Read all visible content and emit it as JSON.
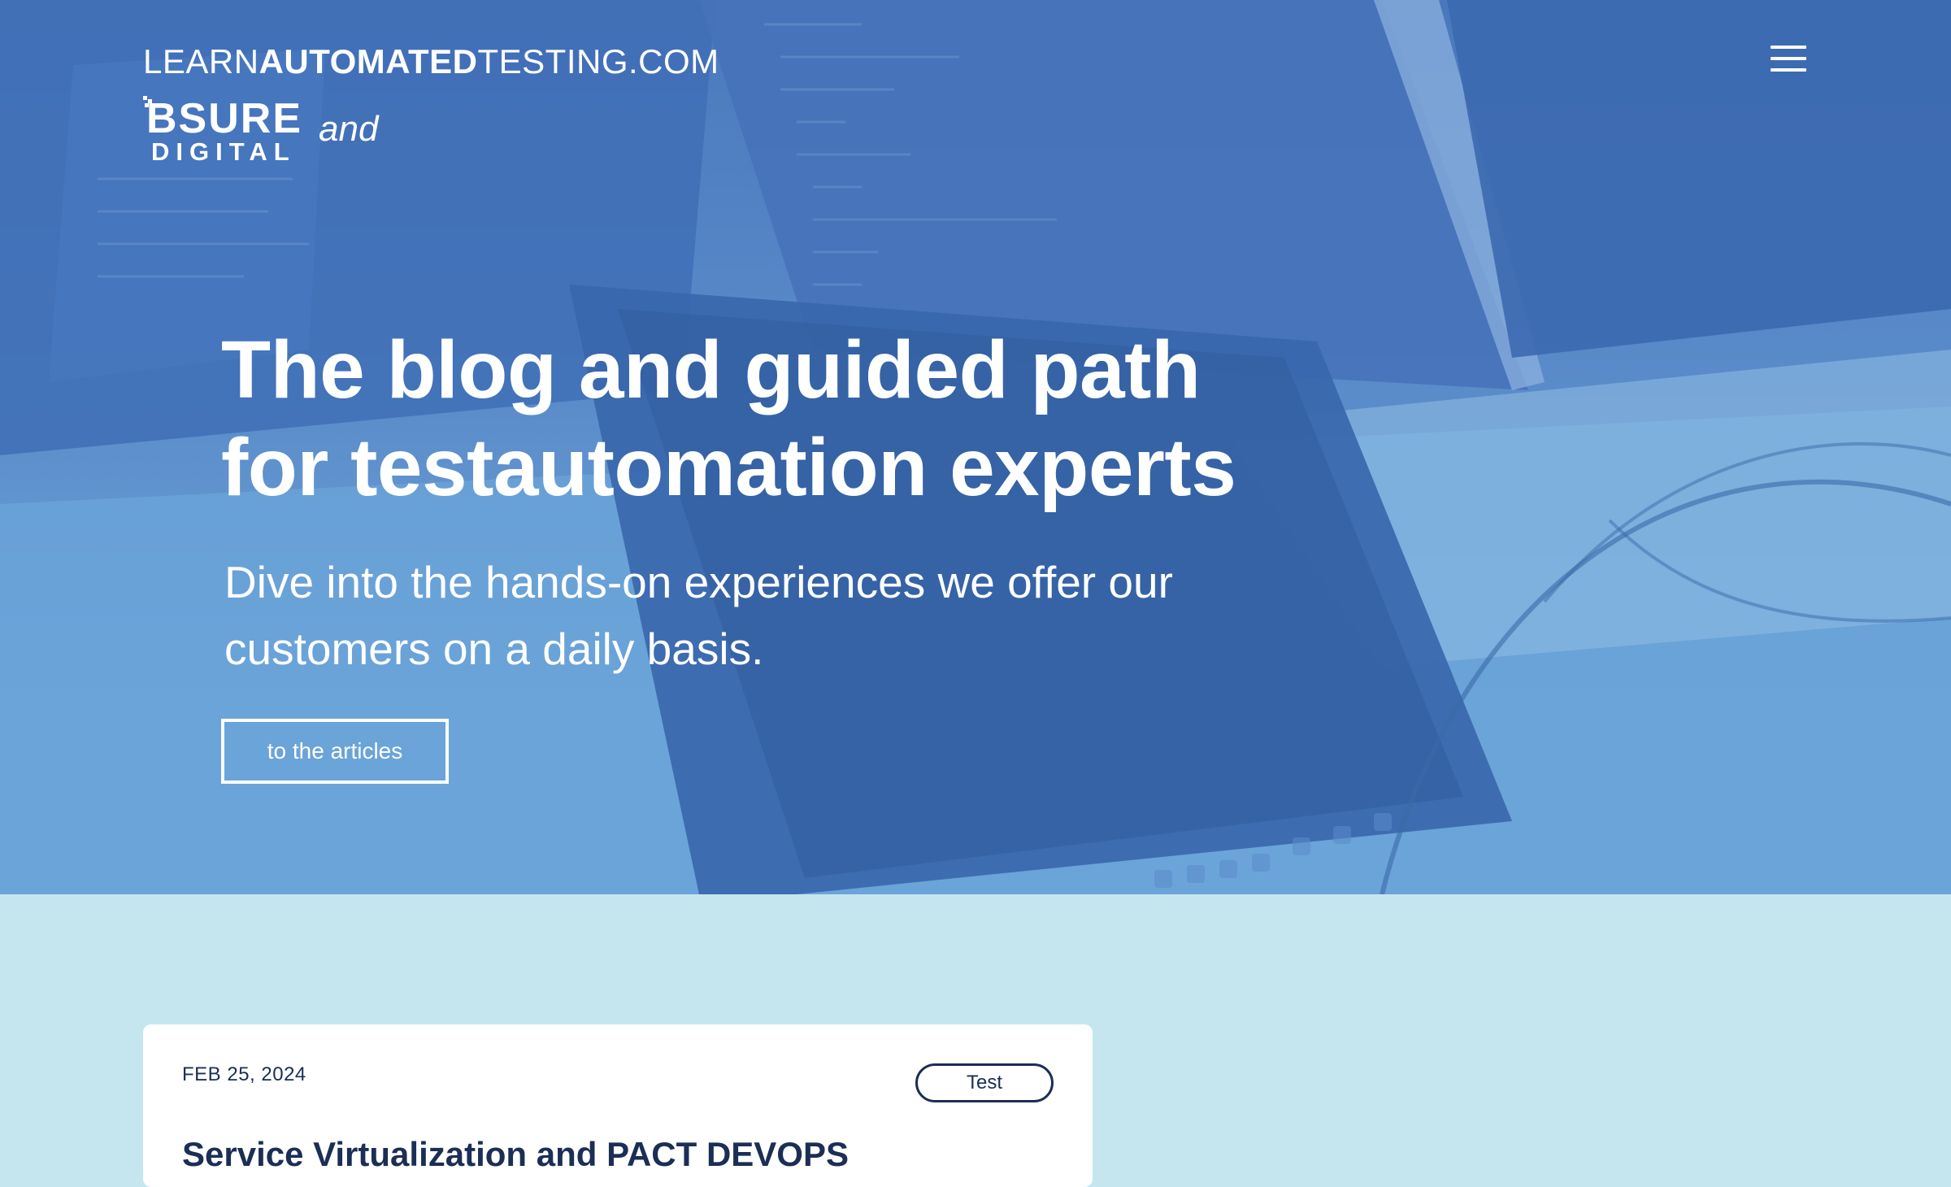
{
  "header": {
    "brand_part1": "LEARN",
    "brand_part2": "AUTOMATED",
    "brand_part3": "TESTING.COM",
    "partner_logo_line1": "BSURE",
    "partner_logo_line2": "DIGITAL",
    "connector": "and",
    "menu_icon": "hamburger-menu-icon"
  },
  "hero": {
    "headline_line1": "The blog and guided path",
    "headline_line2": "for testautomation experts",
    "subheadline": "Dive into the hands-on experiences we offer our customers on a daily basis.",
    "cta_label": "to the articles"
  },
  "articles": [
    {
      "date": "FEB 25, 2024",
      "tag": "Test",
      "title": "Service Virtualization and PACT DEVOPS"
    }
  ],
  "colors": {
    "hero_overlay": "#4f7fc2",
    "page_background": "#c6e6ef",
    "card_background": "#ffffff",
    "card_text": "#1b2e55",
    "hero_text": "#ffffff"
  }
}
